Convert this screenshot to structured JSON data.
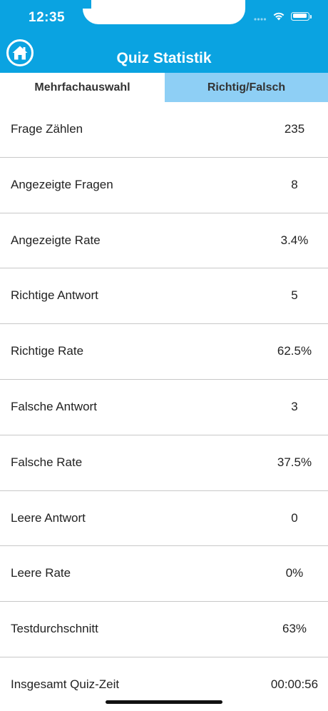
{
  "status_bar": {
    "time": "12:35"
  },
  "header": {
    "title": "Quiz Statistik",
    "home_icon": "home-icon",
    "background_color": "#0aa3e1"
  },
  "tabs": [
    {
      "label": "Mehrfachauswahl",
      "active": true
    },
    {
      "label": "Richtig/Falsch",
      "active": false
    }
  ],
  "stats": [
    {
      "label": "Frage Zählen",
      "value": "235"
    },
    {
      "label": "Angezeigte Fragen",
      "value": "8"
    },
    {
      "label": "Angezeigte Rate",
      "value": "3.4%"
    },
    {
      "label": "Richtige Antwort",
      "value": "5"
    },
    {
      "label": "Richtige Rate",
      "value": "62.5%"
    },
    {
      "label": "Falsche Antwort",
      "value": "3"
    },
    {
      "label": "Falsche Rate",
      "value": "37.5%"
    },
    {
      "label": "Leere Antwort",
      "value": "0"
    },
    {
      "label": "Leere Rate",
      "value": "0%"
    },
    {
      "label": "Testdurchschnitt",
      "value": "63%"
    },
    {
      "label": "Insgesamt Quiz-Zeit",
      "value": "00:00:56"
    }
  ]
}
